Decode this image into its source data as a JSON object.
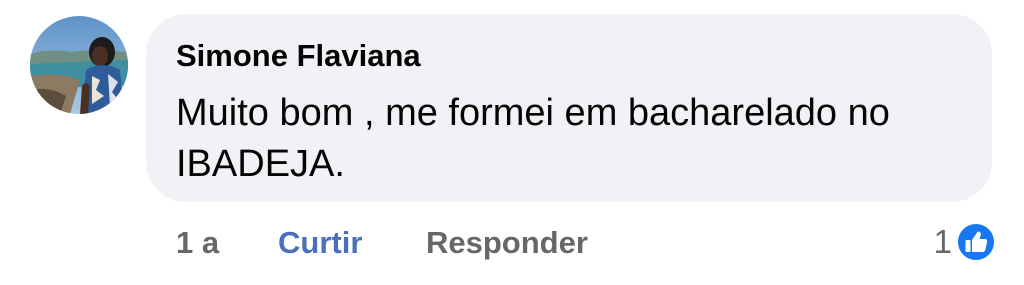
{
  "comment": {
    "author": "Simone Flaviana",
    "text": "Muito bom , me formei em bacharelado no IBADEJA.",
    "time": "1 a",
    "like_label": "Curtir",
    "reply_label": "Responder",
    "reaction_count": "1",
    "reaction_icon": "thumbs-up-icon"
  },
  "colors": {
    "bubble": "#f0f2f5",
    "author_text": "#050505",
    "meta_text": "#65676b",
    "like_action": "#4a6fbd",
    "reaction_blue": "#1877f2"
  }
}
